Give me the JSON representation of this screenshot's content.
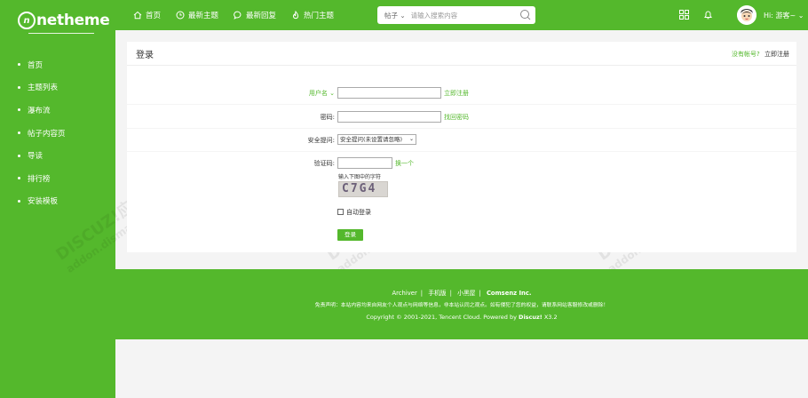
{
  "brand": {
    "logo_mark": "n",
    "logo_text": "netheme"
  },
  "sidebar": {
    "items": [
      {
        "label": "首页"
      },
      {
        "label": "主题列表"
      },
      {
        "label": "瀑布流"
      },
      {
        "label": "帖子内容页"
      },
      {
        "label": "导读"
      },
      {
        "label": "排行榜"
      },
      {
        "label": "安装模板"
      }
    ]
  },
  "topnav": {
    "items": [
      {
        "label": "首页",
        "icon": "home-icon"
      },
      {
        "label": "最新主题",
        "icon": "clock-icon"
      },
      {
        "label": "最新回复",
        "icon": "chat-icon"
      },
      {
        "label": "热门主题",
        "icon": "flame-icon"
      }
    ],
    "search_type": "帖子",
    "search_placeholder": "请输入搜索内容",
    "user_greeting": "Hi: 游客~"
  },
  "login": {
    "title": "登录",
    "no_account": "没有帐号?",
    "register_now": "立即注册",
    "username_label": "用户名",
    "username_link": "立即注册",
    "password_label": "密码:",
    "password_link": "找回密码",
    "question_label": "安全提问:",
    "question_value": "安全提问(未设置请忽略)",
    "captcha_label": "验证码:",
    "captcha_refresh": "换一个",
    "captcha_hint": "输入下图中的字符",
    "captcha_text": "C7G4",
    "auto_login": "自动登录",
    "submit": "登录"
  },
  "footer": {
    "links": [
      "Archiver",
      "手机版",
      "小黑屋"
    ],
    "company": "Comsenz Inc.",
    "disclaimer": "免责声明：本站内容均来自网友个人观点与网络等信息，非本站认同之观点。如有侵犯了您的权益，请联系网站客服修改或删除！",
    "copyright": "Copyright © 2001-2021, Tencent Cloud. Powered by",
    "powered": "Discuz!",
    "version": "X3.2"
  },
  "watermark": {
    "line1": "DISCUZ!应用中心 | 贰道",
    "line2": "addon.dismall.com"
  },
  "colors": {
    "accent": "#54b82c",
    "background": "#f4f4f4"
  }
}
